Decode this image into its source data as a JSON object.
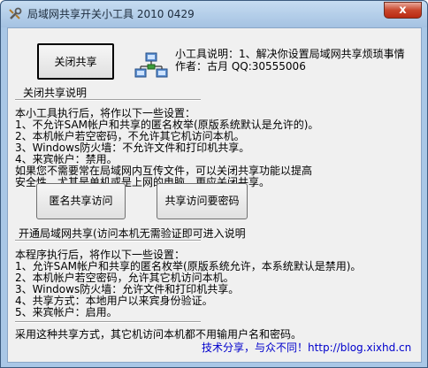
{
  "window": {
    "title": "局域网共享开关小工具 2010 0429",
    "close_label": "x"
  },
  "buttons": {
    "close_share": "关闭共享",
    "anon_access": "匿名共享访问",
    "pwd_access": "共享访问要密码"
  },
  "info": {
    "line1": "小工具说明：1、解决你设置局域网共享烦琐事情",
    "line2": "作者：古月 QQ:30555006"
  },
  "close_section": {
    "label": "关闭共享说明",
    "lines": [
      "本小工具执行后，将作以下一些设置：",
      "1、不允许SAM帐户和共享的匿名枚举(原版系统默认是允许的)。",
      "2、本机帐户若空密码，不允许其它机访问本机。",
      "3、Windows防火墙：不允许文件和打印机共享。",
      "4、来宾帐户：禁用。",
      " 如果您不需要常在局域网内互传文件，可以关闭共享功能以提高",
      "安全性，尤其是单机或是上网的电脑，更应关闭共享。"
    ]
  },
  "open_section": {
    "label": "开通局域网共享(访问本机无需验证即可进入说明",
    "lines": [
      "本程序执行后，将作以下一些设置：",
      "1、允许SAM帐户和共享的匿名枚举(原版系统允许，本系统默认是禁用)。",
      "2、本机帐户若空密码，允许其它机访问本机。",
      "3、Windows防火墙：允许文件和打印机共享。",
      "4、共享方式：本地用户以来宾身份验证。",
      "5、来宾帐户：启用。",
      "",
      "采用这种共享方式，其它机访问本机都不用输用户名和密码。"
    ]
  },
  "footer": {
    "link": "技术分享，与众不同！http://blog.xixhd.cn"
  }
}
